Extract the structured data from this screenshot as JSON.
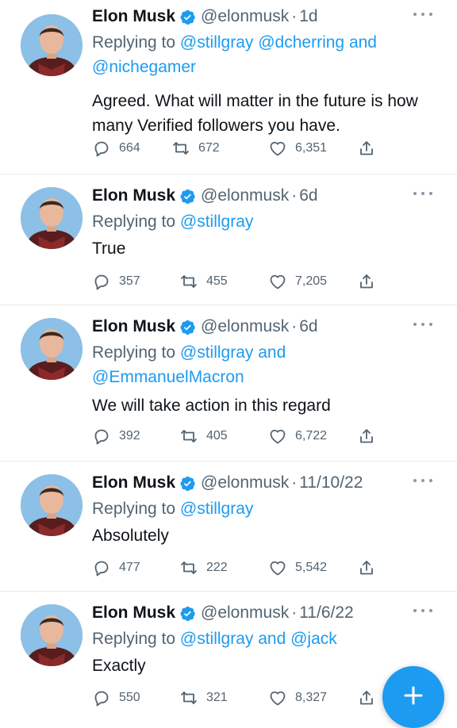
{
  "colors": {
    "accent": "#1d9bf0",
    "secondary_text": "#536471",
    "divider": "#e6e9eb"
  },
  "tweets": [
    {
      "name": "Elon Musk",
      "handle": "@elonmusk",
      "separator": "·",
      "time": "1d",
      "replying_prefix": "Replying to",
      "replying_line1": "@stillgray @dcherring and",
      "replying_line2": "@nichegamer",
      "text": "Agreed. What will matter in the future is how many Verified followers you have.",
      "replies": "664",
      "retweets": "672",
      "likes": "6,351"
    },
    {
      "name": "Elon Musk",
      "handle": "@elonmusk",
      "separator": "·",
      "time": "6d",
      "replying_prefix": "Replying to",
      "replying_line1": "@stillgray",
      "replying_line2": "",
      "text": "True",
      "replies": "357",
      "retweets": "455",
      "likes": "7,205"
    },
    {
      "name": "Elon Musk",
      "handle": "@elonmusk",
      "separator": "·",
      "time": "6d",
      "replying_prefix": "Replying to",
      "replying_line1": "@stillgray and",
      "replying_line2": "@EmmanuelMacron",
      "text": "We will take action in this regard",
      "replies": "392",
      "retweets": "405",
      "likes": "6,722"
    },
    {
      "name": "Elon Musk",
      "handle": "@elonmusk",
      "separator": "·",
      "time": "11/10/22",
      "replying_prefix": "Replying to",
      "replying_line1": "@stillgray",
      "replying_line2": "",
      "text": "Absolutely",
      "replies": "477",
      "retweets": "222",
      "likes": "5,542"
    },
    {
      "name": "Elon Musk",
      "handle": "@elonmusk",
      "separator": "·",
      "time": "11/6/22",
      "replying_prefix": "Replying to",
      "replying_line1": "@stillgray and @jack",
      "replying_line2": "",
      "text": "Exactly",
      "replies": "550",
      "retweets": "321",
      "likes": "8,327"
    }
  ],
  "icons": {
    "verified": "verified-badge-icon",
    "more": "more-options-icon",
    "reply": "reply-icon",
    "retweet": "retweet-icon",
    "like": "heart-icon",
    "share": "share-icon",
    "compose": "plus-icon"
  }
}
